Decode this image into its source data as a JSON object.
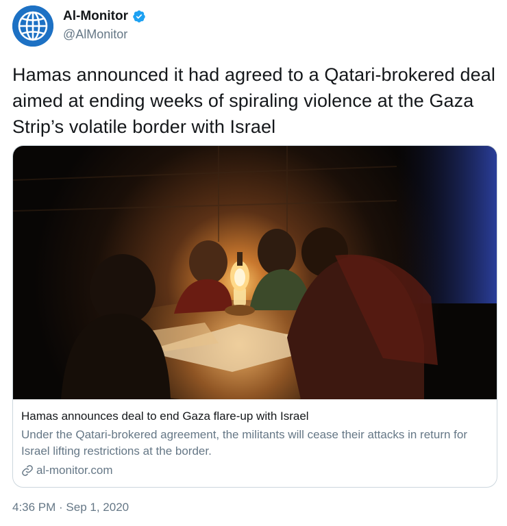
{
  "author": {
    "display_name": "Al-Monitor",
    "handle": "@AlMonitor",
    "verified": true,
    "avatar_icon": "globe-icon",
    "avatar_color": "#1d71c4"
  },
  "tweet": {
    "text": "Hamas announced it had agreed to a Qatari-brokered deal aimed at ending weeks of spiraling violence at the Gaza Strip’s volatile border with Israel",
    "timestamp": "4:36 PM · Sep 1, 2020"
  },
  "card": {
    "image_subject": "Children reading by lamplight in the dark",
    "title": "Hamas announces deal to end Gaza flare-up with Israel",
    "description": "Under the Qatari-brokered agreement, the militants will cease their attacks in return for Israel lifting restrictions at the border.",
    "domain": "al-monitor.com",
    "domain_icon": "link-icon"
  },
  "colors": {
    "text_primary": "#14171a",
    "text_secondary": "#657786",
    "border": "#ccd6dd",
    "verified_blue": "#1da1f2"
  }
}
